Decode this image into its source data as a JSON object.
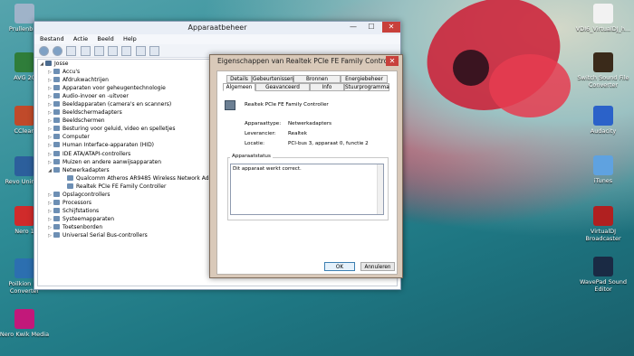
{
  "desktop": {
    "icons_left": [
      {
        "label": "Prullenbak",
        "icon": "recycle-bin-icon"
      },
      {
        "label": "AVG 20",
        "icon": "avg-icon"
      },
      {
        "label": "CClean",
        "icon": "ccleaner-icon"
      },
      {
        "label": "Revo Uninsta",
        "icon": "revo-icon"
      },
      {
        "label": "Nero 1",
        "icon": "nero-icon"
      },
      {
        "label": "Poilkion Im Converter",
        "icon": "converter-icon"
      },
      {
        "label": "Nero Kwik Media",
        "icon": "nero-kwik-icon"
      }
    ],
    "icons_right": [
      {
        "label": "VDI6_VirtualDJ_h...",
        "icon": "pdf-icon"
      },
      {
        "label": "Switch Sound File Converter",
        "icon": "switch-icon"
      },
      {
        "label": "Audacity",
        "icon": "audacity-icon"
      },
      {
        "label": "iTunes",
        "icon": "itunes-icon"
      },
      {
        "label": "VirtualDJ Broadcaster",
        "icon": "virtualdj-icon"
      },
      {
        "label": "WavePad Sound Editor",
        "icon": "wavepad-icon"
      }
    ]
  },
  "window": {
    "title": "Apparaatbeheer",
    "menu": [
      "Bestand",
      "Actie",
      "Beeld",
      "Help"
    ],
    "tree_root": "Josse",
    "tree": [
      {
        "label": "Accu's",
        "exp": "▷"
      },
      {
        "label": "Afdrukwachtrijen",
        "exp": "▷"
      },
      {
        "label": "Apparaten voor geheugentechnologie",
        "exp": "▷"
      },
      {
        "label": "Audio-invoer en -uitvoer",
        "exp": "▷"
      },
      {
        "label": "Beeldapparaten (camera's en scanners)",
        "exp": "▷"
      },
      {
        "label": "Beeldschermadapters",
        "exp": "▷"
      },
      {
        "label": "Beeldschermen",
        "exp": "▷"
      },
      {
        "label": "Besturing voor geluid, video en spelletjes",
        "exp": "▷"
      },
      {
        "label": "Computer",
        "exp": "▷"
      },
      {
        "label": "Human Interface-apparaten (HID)",
        "exp": "▷"
      },
      {
        "label": "IDE ATA/ATAPI-controllers",
        "exp": "▷"
      },
      {
        "label": "Muizen en andere aanwijsapparaten",
        "exp": "▷"
      },
      {
        "label": "Netwerkadapters",
        "exp": "◢"
      },
      {
        "label": "Qualcomm Atheros AR9485 Wireless Network Adapter",
        "exp": "",
        "child": true
      },
      {
        "label": "Realtek PCIe FE Family Controller",
        "exp": "",
        "child": true
      },
      {
        "label": "Opslagcontrollers",
        "exp": "▷"
      },
      {
        "label": "Processors",
        "exp": "▷"
      },
      {
        "label": "Schijfstations",
        "exp": "▷"
      },
      {
        "label": "Systeemapparaten",
        "exp": "▷"
      },
      {
        "label": "Toetsenborden",
        "exp": "▷"
      },
      {
        "label": "Universal Serial Bus-controllers",
        "exp": "▷"
      }
    ]
  },
  "dialog": {
    "title": "Eigenschappen van Realtek PCIe FE Family Controller",
    "close": "✕",
    "tabs_back": [
      "Details",
      "Gebeurtenissen",
      "Bronnen",
      "Energiebeheer"
    ],
    "tabs_front": [
      "Algemeen",
      "Geavanceerd",
      "Info",
      "Stuurprogramma"
    ],
    "device_name": "Realtek PCIe FE Family Controller",
    "fields": [
      {
        "label": "Apparaattype:",
        "value": "Netwerkadapters"
      },
      {
        "label": "Leverancier:",
        "value": "Realtek"
      },
      {
        "label": "Locatie:",
        "value": "PCI-bus 3, apparaat 0, functie 2"
      }
    ],
    "status_legend": "Apparaatstatus",
    "status_text": "Dit apparaat werkt correct.",
    "ok": "OK",
    "cancel": "Annuleren"
  }
}
